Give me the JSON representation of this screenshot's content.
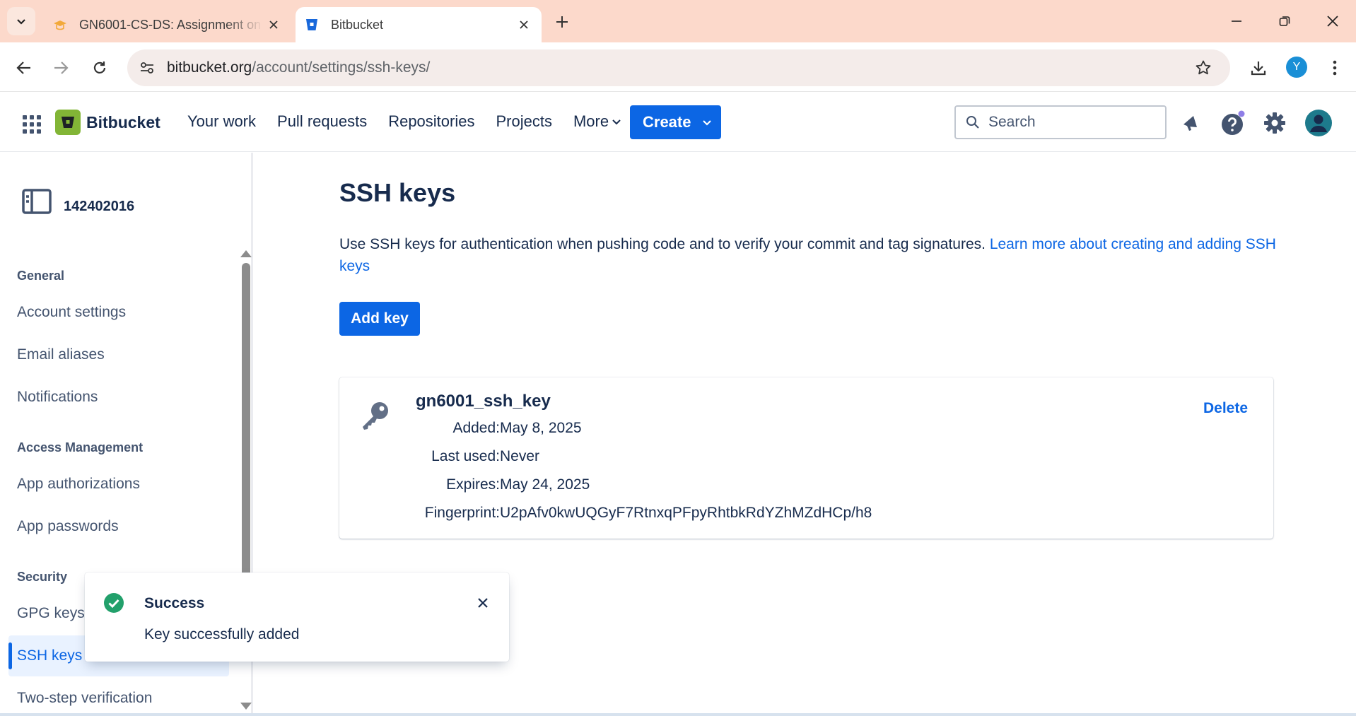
{
  "browser": {
    "tabs": [
      {
        "title": "GN6001-CS-DS: Assignment on",
        "icon": "moodle-hat-icon",
        "active": false
      },
      {
        "title": "Bitbucket",
        "icon": "bitbucket-favicon",
        "active": true
      }
    ],
    "url_host": "bitbucket.org",
    "url_path": "/account/settings/ssh-keys/",
    "profile_initial": "Y",
    "colors": {
      "tabbar": "#fcd9cb",
      "profile": "#1a8fd6"
    }
  },
  "header": {
    "brand": "Bitbucket",
    "nav": [
      "Your work",
      "Pull requests",
      "Repositories",
      "Projects",
      "More"
    ],
    "create_label": "Create",
    "search_placeholder": "Search",
    "colors": {
      "primary": "#0c66e4",
      "logo": "#82b536"
    }
  },
  "sidebar": {
    "workspace": "142402016",
    "sections": [
      {
        "label": "General",
        "items": [
          "Account settings",
          "Email aliases",
          "Notifications"
        ]
      },
      {
        "label": "Access Management",
        "items": [
          "App authorizations",
          "App passwords"
        ]
      },
      {
        "label": "Security",
        "items": [
          "GPG keys",
          "SSH keys",
          "Two-step verification"
        ]
      }
    ],
    "selected": "SSH keys"
  },
  "main": {
    "title": "SSH keys",
    "description": "Use SSH keys for authentication when pushing code and to verify your commit and tag signatures. ",
    "learn_more": "Learn more about creating and adding SSH keys",
    "add_key_label": "Add key",
    "key": {
      "name": "gn6001_ssh_key",
      "delete_label": "Delete",
      "fields": [
        {
          "label": "Added:",
          "value": "May 8, 2025"
        },
        {
          "label": "Last used:",
          "value": "Never"
        },
        {
          "label": "Expires:",
          "value": "May 24, 2025"
        },
        {
          "label": "Fingerprint:",
          "value": "U2pAfv0kwUQGyF7RtnxqPFpyRhtbkRdYZhMZdHCp/h8"
        }
      ]
    }
  },
  "toast": {
    "title": "Success",
    "message": "Key successfully added",
    "status_color": "#22a06b"
  }
}
